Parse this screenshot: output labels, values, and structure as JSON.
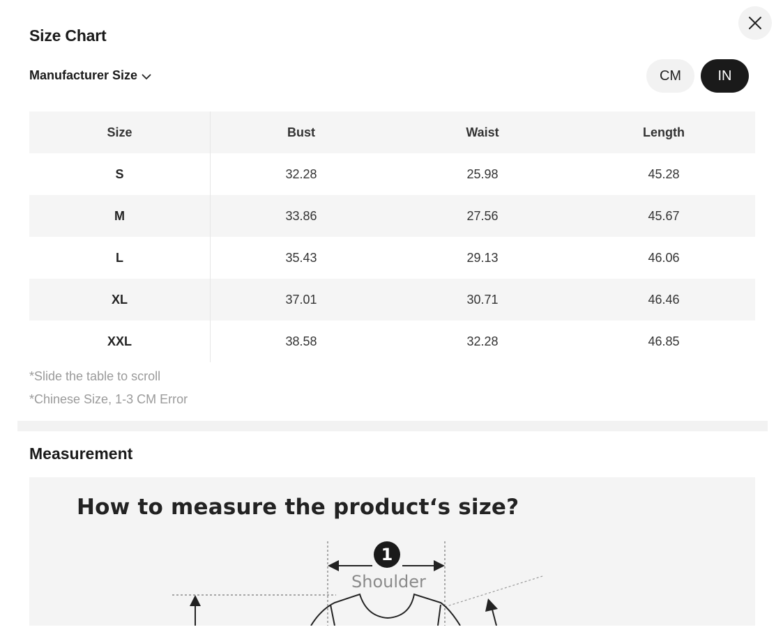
{
  "modal": {
    "title": "Size Chart",
    "size_type": "Manufacturer Size",
    "units": {
      "cm": "CM",
      "in": "IN",
      "selected": "IN"
    }
  },
  "table": {
    "headers": [
      "Size",
      "Bust",
      "Waist",
      "Length"
    ],
    "rows": [
      [
        "S",
        "32.28",
        "25.98",
        "45.28"
      ],
      [
        "M",
        "33.86",
        "27.56",
        "45.67"
      ],
      [
        "L",
        "35.43",
        "29.13",
        "46.06"
      ],
      [
        "XL",
        "37.01",
        "30.71",
        "46.46"
      ],
      [
        "XXL",
        "38.58",
        "32.28",
        "46.85"
      ]
    ]
  },
  "notes": {
    "scroll": "*Slide the table to scroll",
    "error": "*Chinese Size, 1-3 CM Error"
  },
  "measurement": {
    "title": "Measurement",
    "image_heading": "How to measure the product‘s size?",
    "badge": "1",
    "shoulder_label": "Shoulder"
  },
  "colors": {
    "accent": "#1a1a1a",
    "row_alt": "#f5f5f5",
    "note": "#9a9a9a"
  },
  "icons": {
    "close": "close-icon",
    "dropdown": "chevron-down-icon"
  }
}
